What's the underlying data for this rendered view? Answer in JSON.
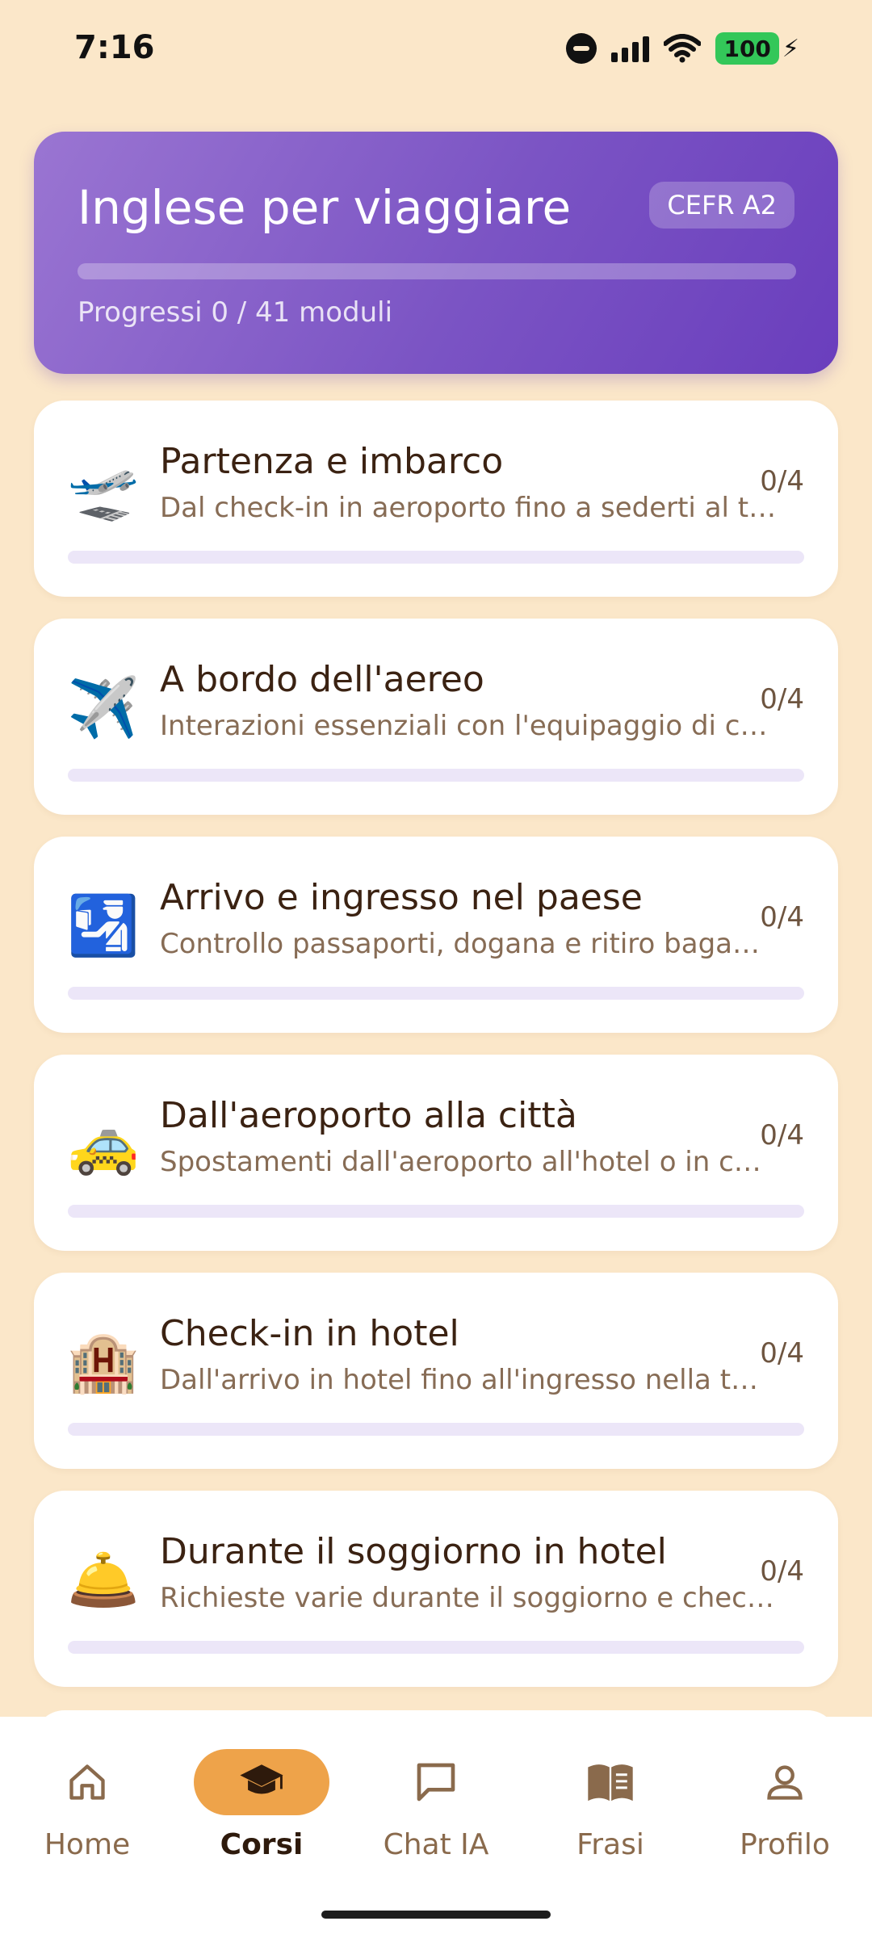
{
  "status_bar": {
    "time": "7:16",
    "battery": "100"
  },
  "hero": {
    "title": "Inglese per viaggiare",
    "badge": "CEFR A2",
    "progress_label": "Progressi 0 / 41 moduli",
    "progress_fraction": 0
  },
  "courses": [
    {
      "icon": "airplane-departure-icon",
      "emoji": "🛫",
      "title": "Partenza e imbarco",
      "desc": "Dal check-in in aeroporto fino a sederti al t…",
      "count": "0/4",
      "progress_fraction": 0
    },
    {
      "icon": "airplane-icon",
      "emoji": "✈️",
      "title": "A bordo dell'aereo",
      "desc": "Interazioni essenziali con l'equipaggio di c…",
      "count": "0/4",
      "progress_fraction": 0
    },
    {
      "icon": "passport-control-icon",
      "emoji": "🛂",
      "title": "Arrivo e ingresso nel paese",
      "desc": "Controllo passaporti, dogana e ritiro baga…",
      "count": "0/4",
      "progress_fraction": 0
    },
    {
      "icon": "taxi-icon",
      "emoji": "🚕",
      "title": "Dall'aeroporto alla città",
      "desc": "Spostamenti dall'aeroporto all'hotel o in c…",
      "count": "0/4",
      "progress_fraction": 0
    },
    {
      "icon": "hotel-icon",
      "emoji": "🏨",
      "title": "Check-in in hotel",
      "desc": "Dall'arrivo in hotel fino all'ingresso nella t…",
      "count": "0/4",
      "progress_fraction": 0
    },
    {
      "icon": "bellhop-bell-icon",
      "emoji": "🛎️",
      "title": "Durante il soggiorno in hotel",
      "desc": "Richieste varie durante il soggiorno e chec…",
      "count": "0/4",
      "progress_fraction": 0
    }
  ],
  "nav": {
    "items": [
      {
        "label": "Home",
        "icon": "home-icon"
      },
      {
        "label": "Corsi",
        "icon": "graduation-cap-icon",
        "active": true
      },
      {
        "label": "Chat IA",
        "icon": "chat-bubble-icon"
      },
      {
        "label": "Frasi",
        "icon": "book-icon"
      },
      {
        "label": "Profilo",
        "icon": "profile-icon"
      }
    ]
  },
  "colors": {
    "background": "#fbe7c9",
    "hero_gradient_start": "#9a75d2",
    "hero_gradient_end": "#6a3ebd",
    "active_nav": "#eea34a",
    "title_text": "#3b2212",
    "secondary_text": "#876c55"
  }
}
